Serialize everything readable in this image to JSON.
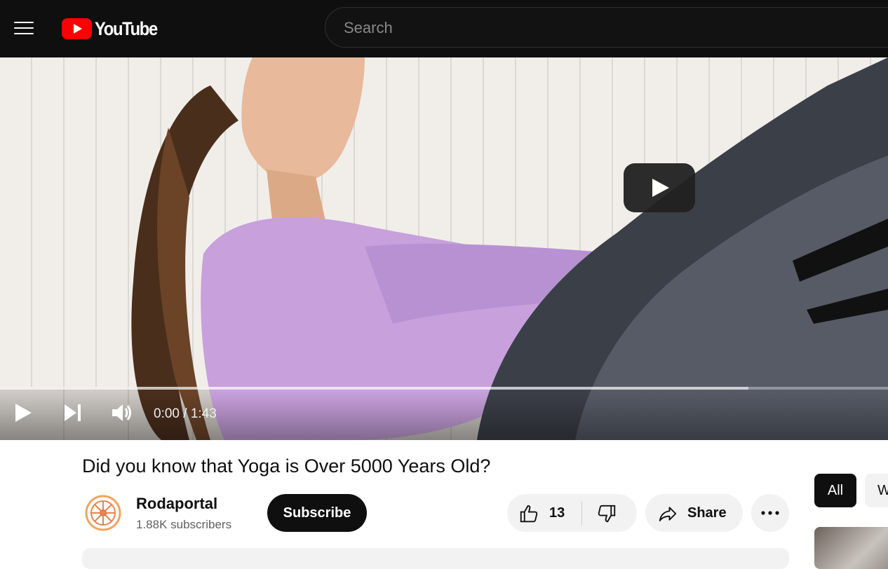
{
  "header": {
    "logo_text": "YouTube",
    "search_placeholder": "Search"
  },
  "player": {
    "current_time": "0:00",
    "separator": "/",
    "duration": "1:43",
    "buffered_fraction": 0.843
  },
  "video": {
    "title": "Did you know that Yoga is Over 5000 Years Old?"
  },
  "channel": {
    "name": "Rodaportal",
    "subscribers": "1.88K subscribers",
    "subscribe_label": "Subscribe"
  },
  "actions": {
    "like_count": "13",
    "share_label": "Share"
  },
  "sidebar": {
    "chips": [
      "All",
      "W"
    ]
  },
  "colors": {
    "brand_red": "#ff0000",
    "header_bg": "#0f0f0f"
  }
}
